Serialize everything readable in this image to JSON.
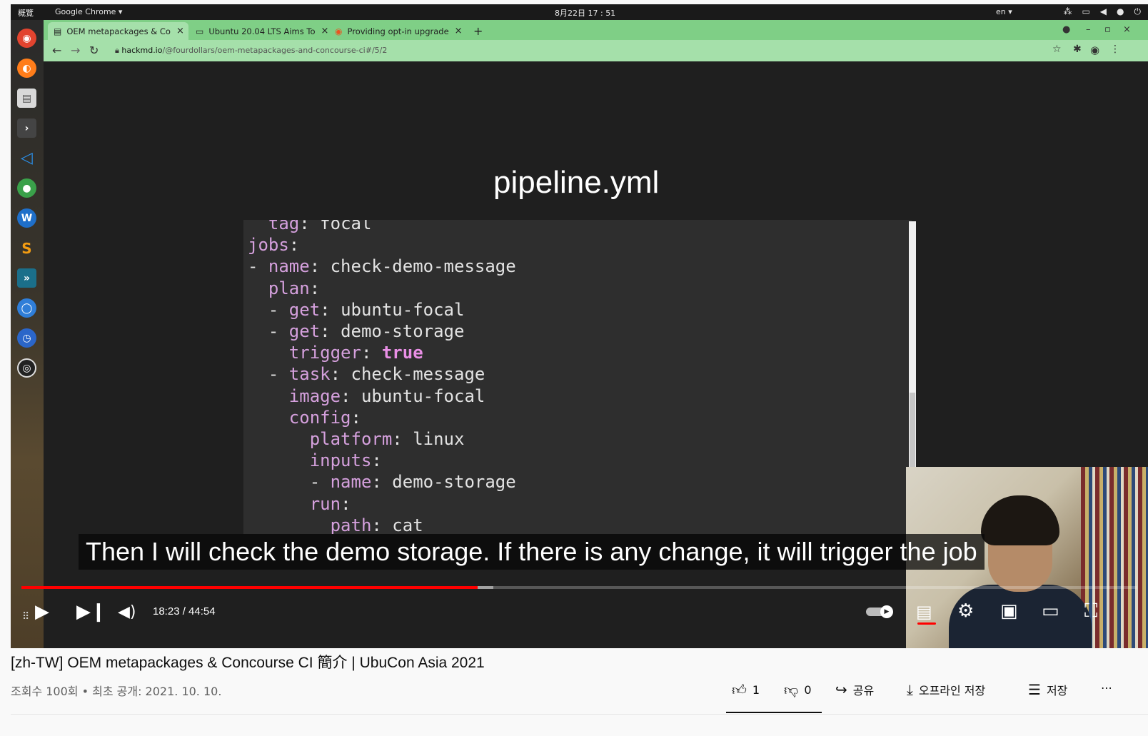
{
  "desktop": {
    "activities": "概覽",
    "app_menu": "Google Chrome ▾",
    "clock": "8月22日  17 : 51",
    "lang": "en ▾"
  },
  "browser": {
    "tabs": [
      {
        "label": "OEM metapackages & Co",
        "close": "×"
      },
      {
        "label": "Ubuntu 20.04 LTS Aims To",
        "close": "×"
      },
      {
        "label": "Providing opt-in upgrade",
        "close": "×"
      }
    ],
    "new_tab": "+",
    "url_host": "hackmd.io",
    "url_path": "/@fourdollars/oem-metapackages-and-concourse-ci#/5/2"
  },
  "slide": {
    "title": "pipeline.yml",
    "code": [
      {
        "indent": "  ",
        "dash": "",
        "key": "tag",
        "sep": ": ",
        "value": "focal",
        "bold": false
      },
      {
        "indent": "",
        "dash": "",
        "key": "jobs",
        "sep": ":",
        "value": "",
        "bold": false
      },
      {
        "indent": "",
        "dash": "- ",
        "key": "name",
        "sep": ": ",
        "value": "check-demo-message",
        "bold": false
      },
      {
        "indent": "  ",
        "dash": "",
        "key": "plan",
        "sep": ":",
        "value": "",
        "bold": false
      },
      {
        "indent": "  ",
        "dash": "- ",
        "key": "get",
        "sep": ": ",
        "value": "ubuntu-focal",
        "bold": false
      },
      {
        "indent": "  ",
        "dash": "- ",
        "key": "get",
        "sep": ": ",
        "value": "demo-storage",
        "bold": false
      },
      {
        "indent": "    ",
        "dash": "",
        "key": "trigger",
        "sep": ": ",
        "value": "true",
        "bold": true
      },
      {
        "indent": "  ",
        "dash": "- ",
        "key": "task",
        "sep": ": ",
        "value": "check-message",
        "bold": false
      },
      {
        "indent": "    ",
        "dash": "",
        "key": "image",
        "sep": ": ",
        "value": "ubuntu-focal",
        "bold": false
      },
      {
        "indent": "    ",
        "dash": "",
        "key": "config",
        "sep": ":",
        "value": "",
        "bold": false
      },
      {
        "indent": "      ",
        "dash": "",
        "key": "platform",
        "sep": ": ",
        "value": "linux",
        "bold": false
      },
      {
        "indent": "      ",
        "dash": "",
        "key": "inputs",
        "sep": ":",
        "value": "",
        "bold": false
      },
      {
        "indent": "      ",
        "dash": "- ",
        "key": "name",
        "sep": ": ",
        "value": "demo-storage",
        "bold": false
      },
      {
        "indent": "      ",
        "dash": "",
        "key": "run",
        "sep": ":",
        "value": "",
        "bold": false
      },
      {
        "indent": "        ",
        "dash": "",
        "key": "path",
        "sep": ": ",
        "value": "cat",
        "bold": false
      }
    ]
  },
  "player": {
    "caption": "Then I will check the demo storage. If there is any change, it will trigger the job",
    "time_display": "18:23 / 44:54",
    "progress_fraction": 0.409,
    "buffered_fraction": 0.423,
    "colors": {
      "played": "#ff0000",
      "caption_bg": "#080808"
    }
  },
  "video": {
    "title": "[zh-TW] OEM metapackages & Concourse CI 簡介 | UbuCon Asia 2021",
    "meta": "조회수 100회 • 최초 공개: 2021. 10. 10.",
    "like_count": "1",
    "dislike_count": "0",
    "share_label": "공유",
    "download_label": "오프라인 저장",
    "save_label": "저장",
    "more_label": "⋯"
  }
}
